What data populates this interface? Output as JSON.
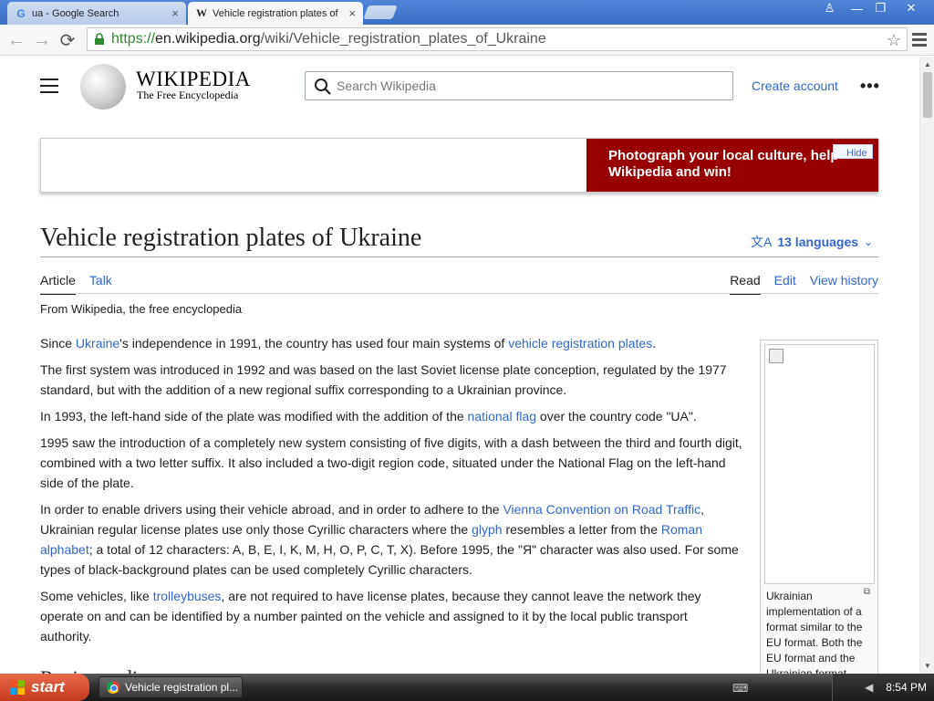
{
  "tabs": [
    {
      "title": "ua - Google Search",
      "close": "×",
      "favicon": "G"
    },
    {
      "title": "Vehicle registration plates of",
      "close": "×",
      "favicon": "W"
    }
  ],
  "window_controls": {
    "user": "♙",
    "minimize": "—",
    "restore": "❐",
    "close": "✕"
  },
  "toolbar": {
    "back": "←",
    "forward": "→",
    "reload": "⟳",
    "url_scheme": "https://",
    "url_host": "en.wikipedia.org",
    "url_path": "/wiki/Vehicle_registration_plates_of_Ukraine",
    "bookmark": "☆"
  },
  "site": {
    "wordmark": "WIKIPEDIA",
    "tagline": "The Free Encyclopedia",
    "search_placeholder": "Search Wikipedia",
    "create_account": "Create account",
    "more": "•••"
  },
  "banner": {
    "text": "Photograph your local culture, help Wikipedia and win!",
    "hide": "Hide"
  },
  "article": {
    "title": "Vehicle registration plates of Ukraine",
    "languages": "13 languages",
    "tab_article": "Article",
    "tab_talk": "Talk",
    "tab_read": "Read",
    "tab_edit": "Edit",
    "tab_history": "View history",
    "from": "From Wikipedia, the free encyclopedia",
    "p1": {
      "a": "Since ",
      "l1": "Ukraine",
      "b": "'s independence in 1991, the country has used four main systems of ",
      "l2": "vehicle registration plates",
      "c": "."
    },
    "p2": "The first system was introduced in 1992 and was based on the last Soviet license plate conception, regulated by the 1977 standard, but with the addition of a new regional suffix corresponding to a Ukrainian province.",
    "p3": {
      "a": "In 1993, the left-hand side of the plate was modified with the addition of the ",
      "l1": "national flag",
      "b": " over the country code \"UA\"."
    },
    "p4": "1995 saw the introduction of a completely new system consisting of five digits, with a dash between the third and fourth digit, combined with a two letter suffix. It also included a two-digit region code, situated under the National Flag on the left-hand side of the plate.",
    "p5": {
      "a": "In order to enable drivers using their vehicle abroad, and in order to adhere to the ",
      "l1": "Vienna Convention on Road Traffic",
      "b": ", Ukrainian regular license plates use only those Cyrillic characters where the ",
      "l2": "glyph",
      "c": " resembles a letter from the ",
      "l3": "Roman alphabet",
      "d": "; a total of 12 characters: A, B, E, I, K, M, H, O, P, C, T, X). Before 1995, the \"Я\" character was also used. For some types of black-background plates can be used completely Cyrillic characters."
    },
    "p6": {
      "a": "Some vehicles, like ",
      "l1": "trolleybuses",
      "b": ", are not required to have license plates, because they cannot leave the network they operate on and can be identified by a number painted on the vehicle and assigned to it by the local public transport authority."
    },
    "section": "Region coding",
    "infobox_caption": "Ukrainian implementation of a format similar to the EU format. Both the EU format and the Ukrainian format"
  },
  "taskbar": {
    "start": "start",
    "item": "Vehicle registration pl...",
    "clock": "8:54 PM"
  }
}
